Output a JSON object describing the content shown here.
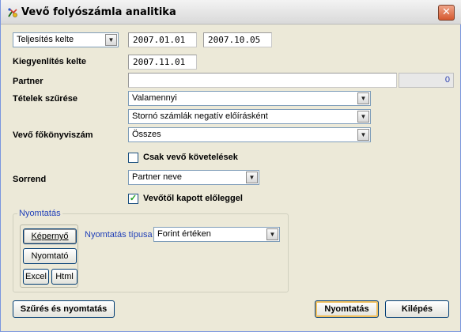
{
  "window": {
    "title": "Vevő folyószámla analitika",
    "close_glyph": "✕"
  },
  "date_filter": {
    "type_selected": "Teljesítés kelte",
    "date_from": "2007.01.01",
    "date_to": "2007.10.05"
  },
  "settlement": {
    "label": "Kiegyenlítés kelte",
    "value": "2007.11.01"
  },
  "partner": {
    "label": "Partner",
    "value": "",
    "count": "0"
  },
  "items_filter": {
    "label": "Tételek szűrése",
    "selected": "Valamennyi",
    "storno_selected": "Stornó számlák negatív előírásként"
  },
  "ledger": {
    "label": "Vevő főkönyviszám",
    "selected": "Összes"
  },
  "only_receivables": {
    "label": "Csak vevő követelések",
    "checked": false
  },
  "order": {
    "label": "Sorrend",
    "selected": "Partner neve"
  },
  "advance": {
    "label": "Vevőtől kapott előleggel",
    "checked": true,
    "check_glyph": "✓"
  },
  "print_group": {
    "legend": "Nyomtatás",
    "screen_button": "Képernyő",
    "printer_button": "Nyomtató",
    "excel_button": "Excel",
    "html_button": "Html",
    "type_label": "Nyomtatás típusa",
    "type_selected": "Forint értéken"
  },
  "footer": {
    "filter_print_button": "Szűrés és nyomtatás",
    "print_button": "Nyomtatás",
    "exit_button": "Kilépés"
  },
  "icons": {
    "dropdown": "▼"
  }
}
